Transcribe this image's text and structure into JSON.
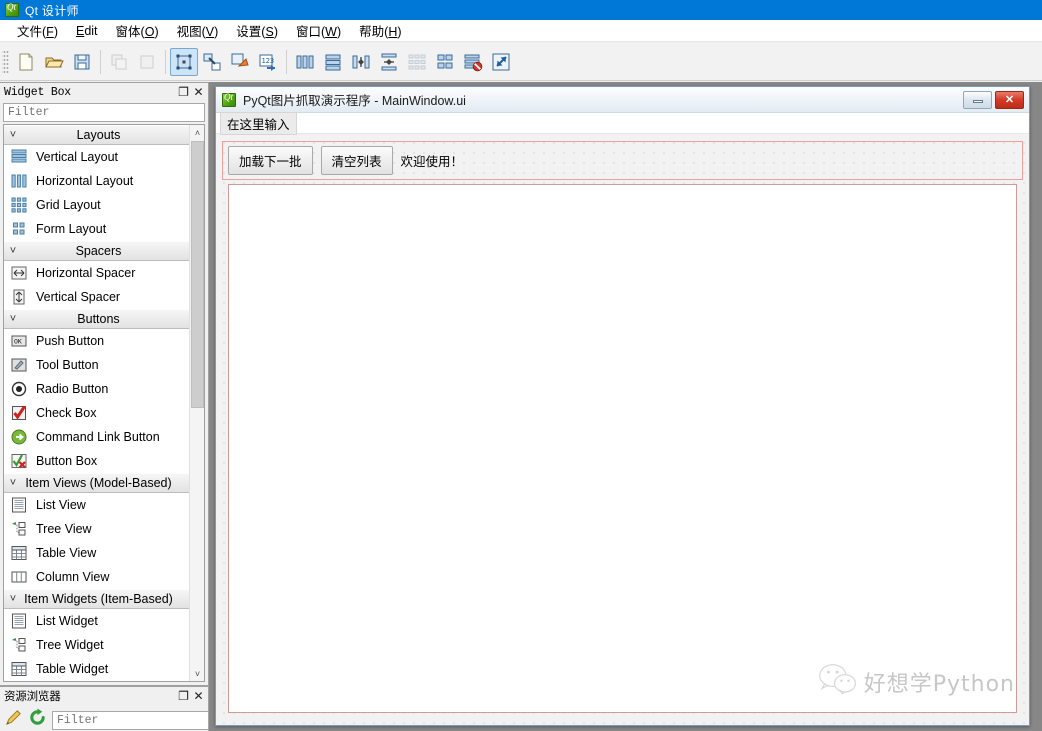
{
  "app": {
    "title": "Qt 设计师",
    "icon": "qt-logo-icon"
  },
  "menubar": {
    "items": [
      {
        "pre": "文件(",
        "key": "F",
        "post": ")",
        "name": "menu-file"
      },
      {
        "pre": "",
        "key": "E",
        "post": "dit",
        "name": "menu-edit"
      },
      {
        "pre": "窗体(",
        "key": "O",
        "post": ")",
        "name": "menu-form"
      },
      {
        "pre": "视图(",
        "key": "V",
        "post": ")",
        "name": "menu-view"
      },
      {
        "pre": "设置(",
        "key": "S",
        "post": ")",
        "name": "menu-settings"
      },
      {
        "pre": "窗口(",
        "key": "W",
        "post": ")",
        "name": "menu-window"
      },
      {
        "pre": "帮助(",
        "key": "H",
        "post": ")",
        "name": "menu-help"
      }
    ]
  },
  "toolbar": {
    "buttons": [
      {
        "name": "new-form-icon",
        "state": "enabled"
      },
      {
        "name": "open-form-icon",
        "state": "enabled"
      },
      {
        "name": "save-form-icon",
        "state": "enabled"
      },
      {
        "name": "undo-icon",
        "state": "disabled"
      },
      {
        "name": "redo-icon",
        "state": "disabled"
      },
      {
        "name": "edit-widgets-icon",
        "state": "selected"
      },
      {
        "name": "edit-signals-slots-icon",
        "state": "enabled"
      },
      {
        "name": "edit-buddies-icon",
        "state": "enabled"
      },
      {
        "name": "edit-tab-order-icon",
        "state": "enabled"
      },
      {
        "name": "layout-horizontally-icon",
        "state": "enabled"
      },
      {
        "name": "layout-vertically-icon",
        "state": "enabled"
      },
      {
        "name": "layout-splitter-horizontal-icon",
        "state": "enabled"
      },
      {
        "name": "layout-splitter-vertical-icon",
        "state": "enabled"
      },
      {
        "name": "layout-in-form-icon",
        "state": "enabled"
      },
      {
        "name": "layout-grid-icon",
        "state": "enabled"
      },
      {
        "name": "break-layout-icon",
        "state": "enabled"
      },
      {
        "name": "adjust-size-icon",
        "state": "enabled"
      }
    ]
  },
  "widget_box": {
    "title": "Widget Box",
    "undock_label": "❐",
    "close_label": "✕",
    "filter_placeholder": "Filter",
    "filter_value": "",
    "scrollbar": {
      "up_arrow": "˄",
      "down_arrow": "˅"
    },
    "groups": [
      {
        "name": "Layouts",
        "expanded": true,
        "items": [
          {
            "label": "Vertical Layout",
            "icon": "vertical-layout-icon"
          },
          {
            "label": "Horizontal Layout",
            "icon": "horizontal-layout-icon"
          },
          {
            "label": "Grid Layout",
            "icon": "grid-layout-icon"
          },
          {
            "label": "Form Layout",
            "icon": "form-layout-icon"
          }
        ]
      },
      {
        "name": "Spacers",
        "expanded": true,
        "items": [
          {
            "label": "Horizontal Spacer",
            "icon": "horizontal-spacer-icon"
          },
          {
            "label": "Vertical Spacer",
            "icon": "vertical-spacer-icon"
          }
        ]
      },
      {
        "name": "Buttons",
        "expanded": true,
        "items": [
          {
            "label": "Push Button",
            "icon": "push-button-icon"
          },
          {
            "label": "Tool Button",
            "icon": "tool-button-icon"
          },
          {
            "label": "Radio Button",
            "icon": "radio-button-icon"
          },
          {
            "label": "Check Box",
            "icon": "check-box-icon"
          },
          {
            "label": "Command Link Button",
            "icon": "command-link-button-icon"
          },
          {
            "label": "Button Box",
            "icon": "button-box-icon"
          }
        ]
      },
      {
        "name": "Item Views (Model-Based)",
        "expanded": true,
        "items": [
          {
            "label": "List View",
            "icon": "list-view-icon"
          },
          {
            "label": "Tree View",
            "icon": "tree-view-icon"
          },
          {
            "label": "Table View",
            "icon": "table-view-icon"
          },
          {
            "label": "Column View",
            "icon": "column-view-icon"
          }
        ]
      },
      {
        "name": "Item Widgets (Item-Based)",
        "expanded": true,
        "items": [
          {
            "label": "List Widget",
            "icon": "list-widget-icon"
          },
          {
            "label": "Tree Widget",
            "icon": "tree-widget-icon"
          },
          {
            "label": "Table Widget",
            "icon": "table-widget-icon"
          }
        ]
      }
    ]
  },
  "resource_browser": {
    "title": "资源浏览器",
    "undock_label": "❐",
    "close_label": "✕",
    "edit_icon": "pencil-edit-icon",
    "reload_icon": "reload-refresh-icon",
    "filter_placeholder": "Filter",
    "filter_value": ""
  },
  "form_window": {
    "title": "PyQt图片抓取演示程序 - MainWindow.ui",
    "icon": "qt-form-icon",
    "minimize_label": "",
    "close_label": "✕",
    "menu_placeholder": "在这里输入",
    "buttons": [
      {
        "label": "加载下一批",
        "name": "load-next-batch-button"
      },
      {
        "label": "清空列表",
        "name": "clear-list-button"
      }
    ],
    "status_label": "欢迎使用！",
    "list_widget_name": "image-list-widget",
    "list_items": []
  },
  "watermark": {
    "text": "好想学Python",
    "icon": "wechat-logo-icon"
  },
  "colors": {
    "title_bar": "#0078d7",
    "selection": "#cce4f7",
    "layout_outline": "#e8a0a0",
    "mdi_background": "#878787",
    "close_button": "#d33a26"
  }
}
